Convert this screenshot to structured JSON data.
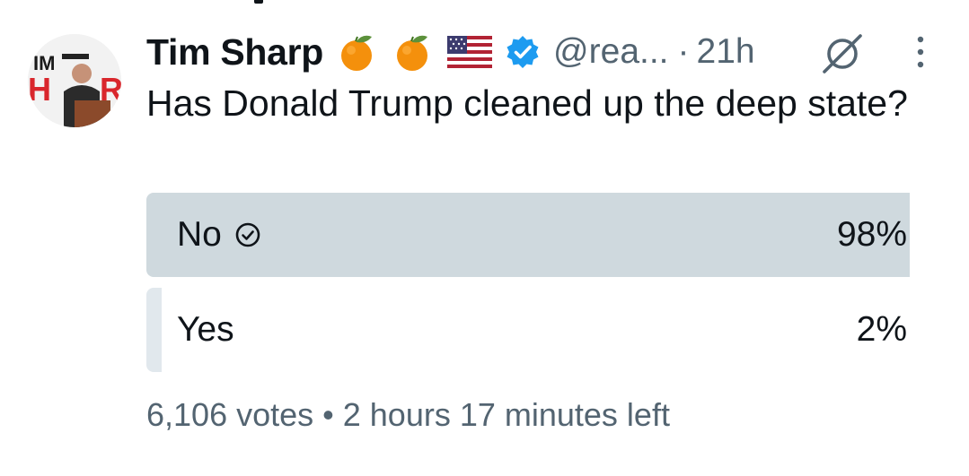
{
  "tweet": {
    "author": {
      "display_name": "Tim Sharp",
      "handle": "@rea...",
      "verified_color": "#1d9bf0",
      "badges": [
        "tangerine-emoji",
        "tangerine-emoji",
        "us-flag-emoji"
      ],
      "avatar_text": "IM SHAR"
    },
    "separator": "·",
    "time": "21h",
    "text": "Has Donald Trump cleaned up the deep state?",
    "poll": {
      "options": [
        {
          "label": "No",
          "percent": "98%",
          "share": 0.98,
          "winner": true
        },
        {
          "label": "Yes",
          "percent": "2%",
          "share": 0.02,
          "winner": false
        }
      ],
      "votes": "6,106 votes",
      "bullet": "•",
      "time_left": "2 hours 17 minutes left"
    }
  },
  "colors": {
    "text_primary": "#0f1419",
    "text_secondary": "#536471",
    "winner_fill": "#cfd9de",
    "other_fill": "#e1e8ed"
  }
}
